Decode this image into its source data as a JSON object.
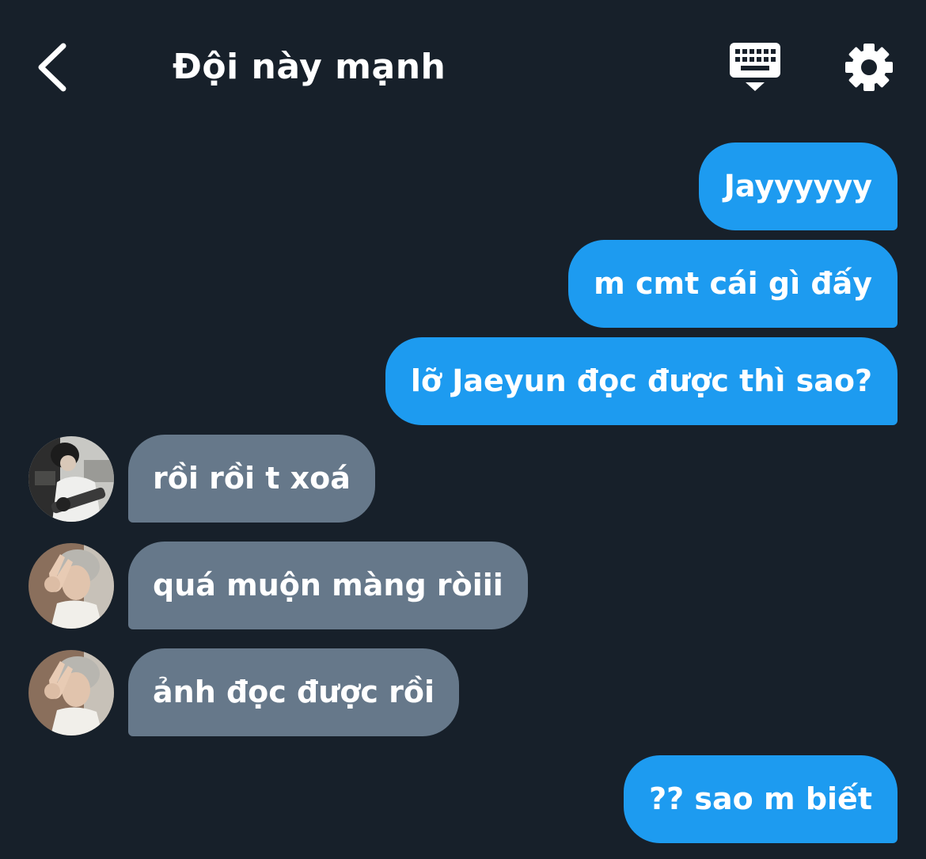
{
  "header": {
    "title": "Đội này mạnh",
    "back_icon": "chevron-left-icon",
    "keyboard_icon": "keyboard-icon",
    "settings_icon": "gear-icon"
  },
  "colors": {
    "background": "#17202a",
    "outgoing_bubble": "#1d9bf0",
    "incoming_bubble": "#66788a",
    "text": "#ffffff"
  },
  "messages": [
    {
      "direction": "outgoing",
      "text": "Jayyyyyy"
    },
    {
      "direction": "outgoing",
      "text": "m cmt cái gì đấy"
    },
    {
      "direction": "outgoing",
      "text": "lỡ Jaeyun đọc được thì sao?"
    },
    {
      "direction": "incoming",
      "text": "rồi rồi t xoá",
      "avatar": "avatar-guitar"
    },
    {
      "direction": "incoming",
      "text": "quá muộn màng ròiii",
      "avatar": "avatar-peace-sign"
    },
    {
      "direction": "incoming",
      "text": "ảnh đọc được rồi",
      "avatar": "avatar-peace-sign"
    },
    {
      "direction": "outgoing",
      "text": "?? sao m biết"
    }
  ]
}
